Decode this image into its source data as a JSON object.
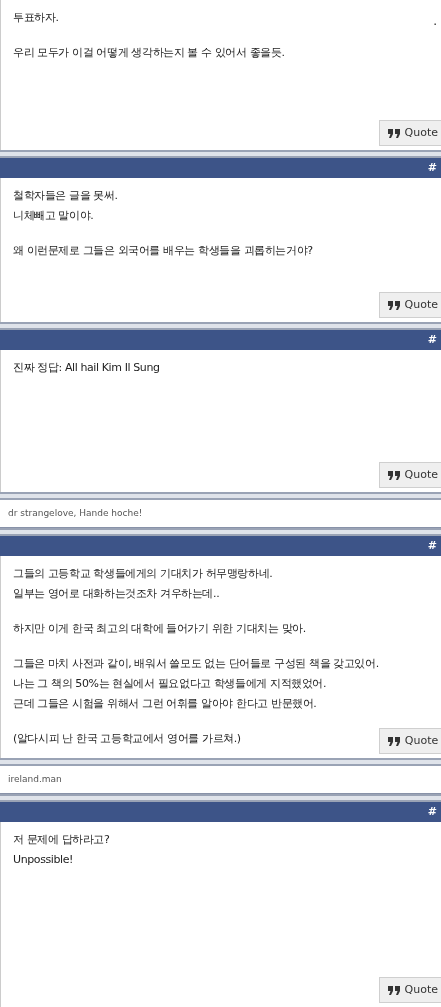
{
  "posts": [
    {
      "corner_mark": ".",
      "paragraphs": [
        [
          "투표하자."
        ],
        [
          "우리 모두가 이걸 어떻게 생각하는지 볼 수 있어서 좋을듯."
        ]
      ],
      "quote_button": "Quote"
    },
    {
      "header": {
        "mark": "#"
      },
      "paragraphs": [
        [
          "철학자들은 글을 못써.",
          "니체빼고 말이야."
        ],
        [
          "왜 이런문제로 그들은 외국어를 배우는 학생들을 괴롭히는거야?"
        ]
      ],
      "quote_button": "Quote"
    },
    {
      "header": {
        "mark": "#"
      },
      "paragraphs": [
        [
          "진짜 정답: All hail Kim Il Sung"
        ]
      ],
      "quote_button": "Quote",
      "signature": "dr strangelove, Hande hoche!"
    },
    {
      "header": {
        "mark": "#"
      },
      "paragraphs": [
        [
          "그들의 고등학교 학생들에게의 기대치가 허무맹랑하네.",
          "일부는 영어로 대화하는것조차 겨우하는데.."
        ],
        [
          "하지만 이게 한국 최고의 대학에 들어가기 위한 기대치는 맞아."
        ],
        [
          "그들은 마치 사전과 같이, 배워서 쓸모도 없는 단어들로 구성된 책을 갖고있어.",
          "나는 그 책의 50%는 현실에서 필요없다고 학생들에게 지적했었어.",
          "근데 그들은 시험을 위해서 그런 어휘를 알아야 한다고 반문했어."
        ],
        [
          "(알다시피 난 한국 고등학교에서 영어를 가르쳐.)"
        ]
      ],
      "quote_button": "Quote",
      "signature": "ireland.man"
    },
    {
      "header": {
        "mark": "#"
      },
      "paragraphs": [
        [
          "저 문제에 답하라고?",
          "Unpossible!"
        ]
      ],
      "quote_button": "Quote"
    }
  ]
}
